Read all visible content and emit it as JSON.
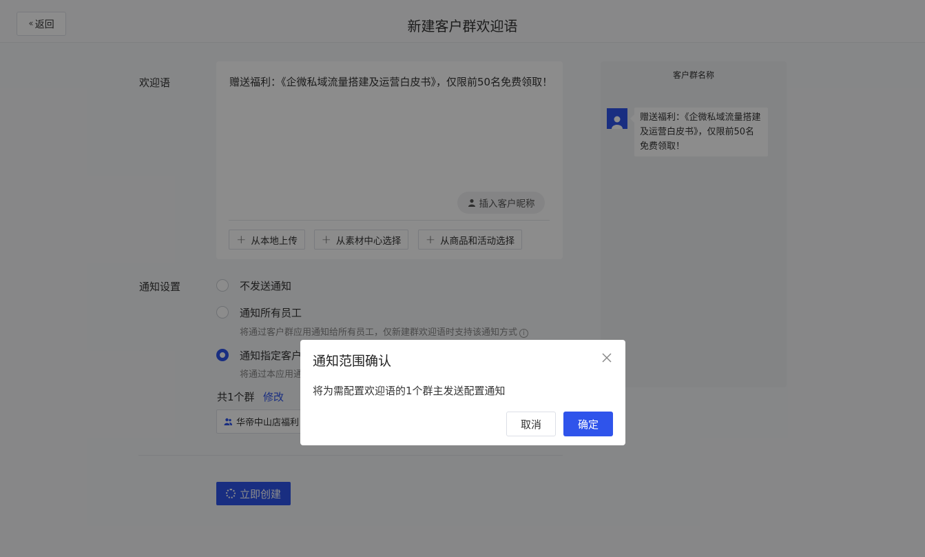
{
  "header": {
    "back_label": "返回",
    "title": "新建客户群欢迎语"
  },
  "form": {
    "welcome_label": "欢迎语",
    "welcome_text": "赠送福利：《企微私域流量搭建及运营白皮书》，仅限前50名免费领取！",
    "insert_nickname": "插入客户昵称",
    "upload_buttons": [
      "从本地上传",
      "从素材中心选择",
      "从商品和活动选择"
    ],
    "notify_label": "通知设置",
    "notify_options": [
      {
        "label": "不发送通知",
        "hint": "",
        "checked": false
      },
      {
        "label": "通知所有员工",
        "hint": "将通过客户群应用通知给所有员工，仅新建群欢迎语时支持该通知方式",
        "checked": false
      },
      {
        "label": "通知指定客户",
        "hint": "将通过本应用通",
        "checked": true
      }
    ],
    "group_count": "共1个群",
    "modify_label": "修改",
    "group_tag": "华帝中山店福利",
    "create_label": "立即创建"
  },
  "preview": {
    "title": "客户群名称",
    "message": "赠送福利：《企微私域流量搭建及运营白皮书》，仅限前50名免费领取！"
  },
  "modal": {
    "title": "通知范围确认",
    "body": "将为需配置欢迎语的1个群主发送配置通知",
    "cancel_label": "取消",
    "confirm_label": "确定"
  },
  "colors": {
    "accent": "#2f54eb",
    "overlay": "rgba(0,0,0,0.45)"
  }
}
